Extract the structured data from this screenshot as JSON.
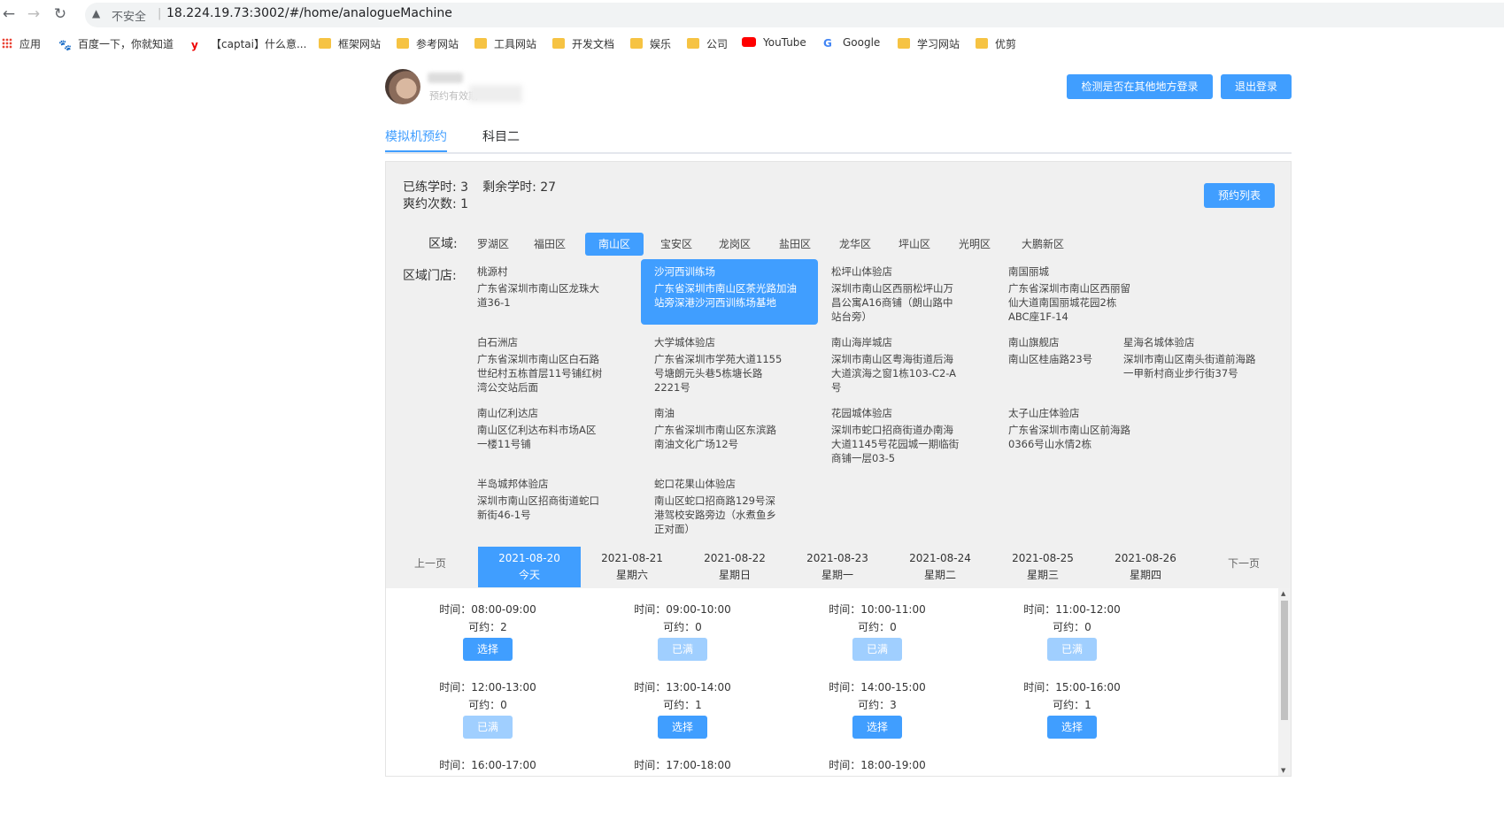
{
  "browser": {
    "insecure_label": "不安全",
    "url": "18.224.19.73:3002/#/home/analogueMachine",
    "bookmarks": [
      "应用",
      "百度一下，你就知道",
      "【captai】什么意...",
      "框架网站",
      "参考网站",
      "工具网站",
      "开发文档",
      "娱乐",
      "公司",
      "YouTube",
      "Google",
      "学习网站",
      "优剪"
    ]
  },
  "header": {
    "subtitle": "预约有效期",
    "check_login_label": "检测是否在其他地方登录",
    "logout_label": "退出登录"
  },
  "tabs": [
    {
      "label": "模拟机预约",
      "active": true
    },
    {
      "label": "科目二",
      "active": false
    }
  ],
  "stats": {
    "practiced": "已练学时: 3",
    "remaining": "剩余学时: 27",
    "missed": "爽约次数: 1",
    "list_button": "预约列表"
  },
  "district_label": "区域:",
  "districts": [
    "罗湖区",
    "福田区",
    "南山区",
    "宝安区",
    "龙岗区",
    "盐田区",
    "龙华区",
    "坪山区",
    "光明区",
    "大鹏新区"
  ],
  "active_district": "南山区",
  "store_label": "区域门店:",
  "stores": [
    {
      "name": "桃源村",
      "addr": "广东省深圳市南山区龙珠大道36-1"
    },
    {
      "name": "沙河西训练场",
      "addr": "广东省深圳市南山区茶光路加油站旁深港沙河西训练场基地",
      "active": true
    },
    {
      "name": "松坪山体验店",
      "addr": "深圳市南山区西丽松坪山万昌公寓A16商铺（朗山路中站台旁）"
    },
    {
      "name": "南国丽城",
      "addr": "广东省深圳市南山区西丽留仙大道南国丽城花园2栋ABC座1F-14"
    },
    {
      "name": "白石洲店",
      "addr": "广东省深圳市南山区白石路世纪村五栋首层11号铺红树湾公交站后面"
    },
    {
      "name": "大学城体验店",
      "addr": "广东省深圳市学苑大道1155号塘朗元头巷5栋塘长路2221号"
    },
    {
      "name": "南山海岸城店",
      "addr": "深圳市南山区粤海街道后海大道滨海之窗1栋103-C2-A号"
    },
    {
      "name": "南山旗舰店",
      "addr": "南山区桂庙路23号"
    },
    {
      "name": "星海名城体验店",
      "addr": "深圳市南山区南头街道前海路一甲新村商业步行街37号"
    },
    {
      "name": "南山亿利达店",
      "addr": "南山区亿利达布料市场A区一楼11号铺"
    },
    {
      "name": "南油",
      "addr": "广东省深圳市南山区东滨路南油文化广场12号"
    },
    {
      "name": "花园城体验店",
      "addr": "深圳市蛇口招商街道办南海大道1145号花园城一期临街商铺一层03-5"
    },
    {
      "name": "太子山庄体验店",
      "addr": "广东省深圳市南山区前海路0366号山水情2栋"
    },
    {
      "name": "半岛城邦体验店",
      "addr": "深圳市南山区招商街道蛇口新街46-1号"
    },
    {
      "name": "蛇口花果山体验店",
      "addr": "南山区蛇口招商路129号深港驾校安路旁边（水煮鱼乡正对面）"
    }
  ],
  "days_nav": {
    "prev": "上一页",
    "next": "下一页"
  },
  "days": [
    {
      "date": "2021-08-20",
      "week": "今天",
      "active": true
    },
    {
      "date": "2021-08-21",
      "week": "星期六"
    },
    {
      "date": "2021-08-22",
      "week": "星期日"
    },
    {
      "date": "2021-08-23",
      "week": "星期一"
    },
    {
      "date": "2021-08-24",
      "week": "星期二"
    },
    {
      "date": "2021-08-25",
      "week": "星期三"
    },
    {
      "date": "2021-08-26",
      "week": "星期四"
    }
  ],
  "slots": [
    {
      "time": "时间：08:00-09:00",
      "avail": "可约：2",
      "btn": "选择",
      "full": false
    },
    {
      "time": "时间：09:00-10:00",
      "avail": "可约：0",
      "btn": "已满",
      "full": true
    },
    {
      "time": "时间：10:00-11:00",
      "avail": "可约：0",
      "btn": "已满",
      "full": true
    },
    {
      "time": "时间：11:00-12:00",
      "avail": "可约：0",
      "btn": "已满",
      "full": true
    },
    {
      "time": "时间：12:00-13:00",
      "avail": "可约：0",
      "btn": "已满",
      "full": true
    },
    {
      "time": "时间：13:00-14:00",
      "avail": "可约：1",
      "btn": "选择",
      "full": false
    },
    {
      "time": "时间：14:00-15:00",
      "avail": "可约：3",
      "btn": "选择",
      "full": false
    },
    {
      "time": "时间：15:00-16:00",
      "avail": "可约：1",
      "btn": "选择",
      "full": false
    },
    {
      "time": "时间：16:00-17:00",
      "avail": "",
      "btn": "",
      "full": false
    },
    {
      "time": "时间：17:00-18:00",
      "avail": "",
      "btn": "",
      "full": false
    },
    {
      "time": "时间：18:00-19:00",
      "avail": "",
      "btn": "",
      "full": false
    }
  ]
}
